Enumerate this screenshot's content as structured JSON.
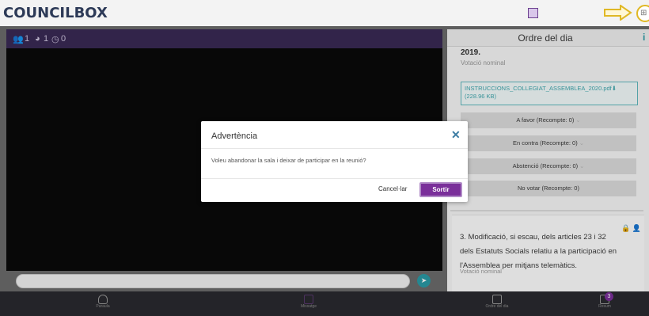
{
  "app": {
    "logo": "COUNCILBOX"
  },
  "video_header": {
    "participants": "1",
    "requests": "1",
    "timer": "0"
  },
  "agenda_panel": {
    "title": "Ordre del dia",
    "info_icon": "info-icon",
    "current_point_tail": "2019.",
    "current_point_vote_type": "Votació nominal",
    "attachment": {
      "name": "INSTRUCCIONS_COLLEGIAT_ASSEMBLEA_2020.pdf",
      "size": "(228.96 KB)"
    },
    "vote_options": [
      {
        "label": "A favor (Recompte: 0)"
      },
      {
        "label": "En contra (Recompte: 0)"
      },
      {
        "label": "Abstenció (Recompte: 0)"
      },
      {
        "label": "No votar (Recompte: 0)"
      }
    ],
    "next_point": {
      "title": "3. Modificació, si escau, dels articles 23 i 32 dels Estatuts Socials relatiu a la participació en l'Assemblea per mitjans telemàtics.",
      "vote_type": "Votació nominal"
    }
  },
  "bottom_bar": {
    "items": [
      {
        "label": "Paraula",
        "icon": "hand-icon"
      },
      {
        "label": "Missatge",
        "icon": "message-icon"
      },
      {
        "label": "Ordre del dia",
        "icon": "calendar-icon"
      },
      {
        "label": "Resum",
        "icon": "document-icon"
      }
    ],
    "resum_badge": "3"
  },
  "modal": {
    "title": "Advertència",
    "message": "Voleu abandonar la sala i deixar de participar en la reunió?",
    "cancel_label": "Cancel·lar",
    "exit_label": "Sortir"
  },
  "colors": {
    "brand": "#2d3a57",
    "accent": "#7a2f9a",
    "teal": "#2a9aa5"
  }
}
